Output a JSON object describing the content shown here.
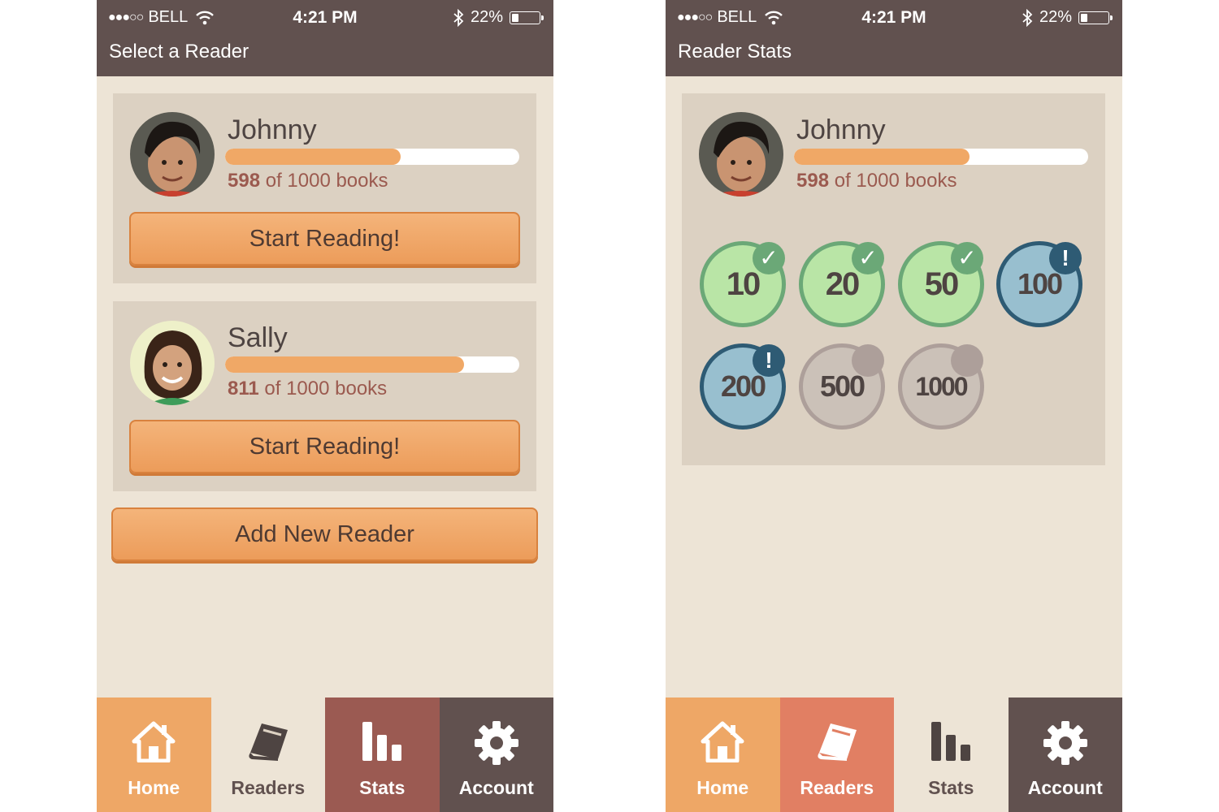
{
  "status": {
    "signal_dots": "●●●○○",
    "carrier": "BELL",
    "time": "4:21 PM",
    "battery": "22%"
  },
  "left": {
    "title": "Select a Reader",
    "readers": [
      {
        "name": "Johnny",
        "count": "598",
        "of_text": "of 1000 books",
        "progress": 0.598,
        "button": "Start Reading!"
      },
      {
        "name": "Sally",
        "count": "811",
        "of_text": "of 1000 books",
        "progress": 0.811,
        "button": "Start Reading!"
      }
    ],
    "add_button": "Add New Reader"
  },
  "right": {
    "title": "Reader Stats",
    "reader": {
      "name": "Johnny",
      "count": "598",
      "of_text": "of 1000 books",
      "progress": 0.598
    },
    "badges": [
      {
        "value": "10",
        "state": "done",
        "mark": "✓"
      },
      {
        "value": "20",
        "state": "done",
        "mark": "✓"
      },
      {
        "value": "50",
        "state": "done",
        "mark": "✓"
      },
      {
        "value": "100",
        "state": "next",
        "mark": "!"
      },
      {
        "value": "200",
        "state": "next",
        "mark": "!"
      },
      {
        "value": "500",
        "state": "locked",
        "mark": ""
      },
      {
        "value": "1000",
        "state": "locked",
        "mark": ""
      }
    ]
  },
  "tabs": {
    "home": "Home",
    "readers": "Readers",
    "stats": "Stats",
    "account": "Account"
  },
  "icons": {
    "home": "house-icon",
    "readers": "book-icon",
    "stats": "bar-chart-icon",
    "account": "gear-icon",
    "wifi": "wifi-icon",
    "bluetooth": "bluetooth-icon",
    "battery": "battery-icon"
  },
  "colors": {
    "header": "#61514f",
    "background": "#ede4d6",
    "card": "#dcd1c2",
    "accent_orange": "#eea766",
    "readers_tab": "#e17f63",
    "stats_tab": "#9b5a52",
    "badge_done": "#b9e5a6",
    "badge_next": "#98bfcf",
    "badge_locked": "#cbc1b8"
  }
}
